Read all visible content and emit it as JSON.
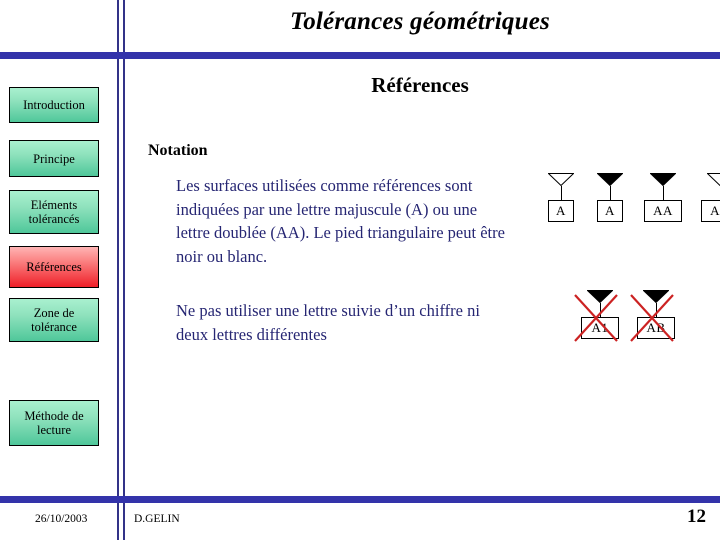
{
  "deck": {
    "title": "Tolérances géométriques",
    "section_title": "Références",
    "rule_color": "#3333aa",
    "divider_color": "#333388"
  },
  "sidebar": {
    "items": [
      {
        "label": "Introduction",
        "active": false
      },
      {
        "label": "Principe",
        "active": false
      },
      {
        "label": "Eléments tolérancés",
        "active": false
      },
      {
        "label": "Références",
        "active": true
      },
      {
        "label": "Zone de tolérance",
        "active": false
      },
      {
        "label": "Méthode de lecture",
        "active": false
      }
    ],
    "normal_color": "#8fe2bd",
    "active_color": "#ef1f28"
  },
  "main": {
    "sub_heading": "Notation",
    "paragraphs": [
      "Les surfaces utilisées comme références sont indiquées par une lettre majuscule (A) ou une lettre doublée (AA). Le pied triangulaire peut être noir ou blanc.",
      "Ne pas utiliser une lettre suivie d’un chiffre ni deux lettres différentes"
    ],
    "text_color": "#262673"
  },
  "figures": {
    "valid_symbols": [
      {
        "letter": "A",
        "triangle": "hollow"
      },
      {
        "letter": "A",
        "triangle": "filled"
      },
      {
        "letter": "AA",
        "triangle": "filled"
      },
      {
        "letter": "AA",
        "triangle": "hollow"
      }
    ],
    "invalid_symbols": [
      {
        "letter": "A1",
        "triangle": "filled",
        "crossed_out": true
      },
      {
        "letter": "AB",
        "triangle": "filled",
        "crossed_out": true
      }
    ],
    "cross_color": "#cc2222"
  },
  "footer": {
    "date": "26/10/2003",
    "author": "D.GELIN",
    "page_number": "12"
  }
}
